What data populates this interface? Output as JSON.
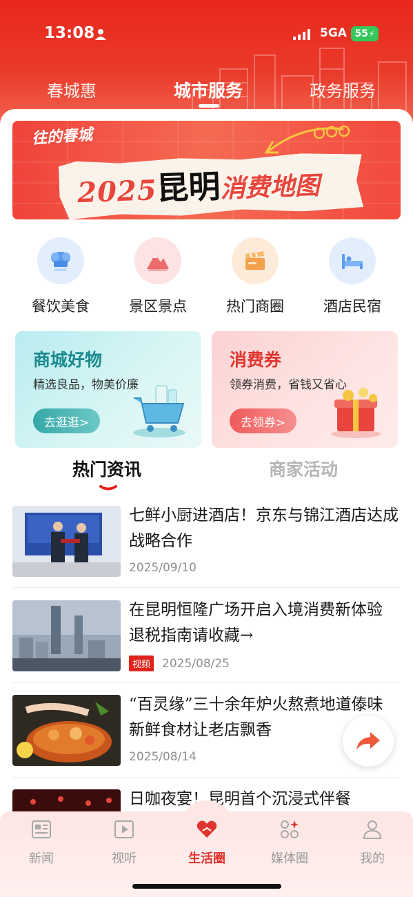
{
  "status_bar": {
    "time": "13:08",
    "network": "5GA",
    "battery": "55"
  },
  "top_tabs": [
    {
      "label": "春城惠"
    },
    {
      "label": "城市服务"
    },
    {
      "label": "政务服务"
    }
  ],
  "banner": {
    "logo_text": "往的春城",
    "year": "2025",
    "city": "昆明",
    "tail": "消费地图"
  },
  "categories": [
    {
      "label": "餐饮美食",
      "icon": "chef-hat-icon"
    },
    {
      "label": "景区景点",
      "icon": "mountain-icon"
    },
    {
      "label": "热门商圈",
      "icon": "clapperboard-icon"
    },
    {
      "label": "酒店民宿",
      "icon": "bed-icon"
    }
  ],
  "promos": [
    {
      "title": "商城好物",
      "subtitle": "精选良品，物美价廉",
      "button": "去逛逛>"
    },
    {
      "title": "消费券",
      "subtitle": "领券消费，省钱又省心",
      "button": "去领券>"
    }
  ],
  "news_tabs": [
    {
      "label": "热门资讯"
    },
    {
      "label": "商家活动"
    }
  ],
  "news": [
    {
      "title": "七鲜小厨进酒店！京东与锦江酒店达成战略合作",
      "date": "2025/09/10",
      "badge": ""
    },
    {
      "title": "在昆明恒隆广场开启入境消费新体验 退税指南请收藏→",
      "date": "2025/08/25",
      "badge": "视频"
    },
    {
      "title": "“百灵缘”三十余年炉火熬煮地道傣味 新鲜食材让老店飘香",
      "date": "2025/08/14",
      "badge": ""
    },
    {
      "title": "日咖夜宴！昆明首个沉浸式伴餐",
      "date": "",
      "badge": ""
    }
  ],
  "bottom_nav": [
    {
      "label": "新闻",
      "icon": "newspaper-icon"
    },
    {
      "label": "视听",
      "icon": "play-icon"
    },
    {
      "label": "生活圈",
      "icon": "heart-hand-icon"
    },
    {
      "label": "媒体圈",
      "icon": "apps-icon"
    },
    {
      "label": "我的",
      "icon": "user-icon"
    }
  ],
  "colors": {
    "brand_red": "#e8271d",
    "active_red": "#e0352e",
    "teal": "#1b8a8c"
  }
}
